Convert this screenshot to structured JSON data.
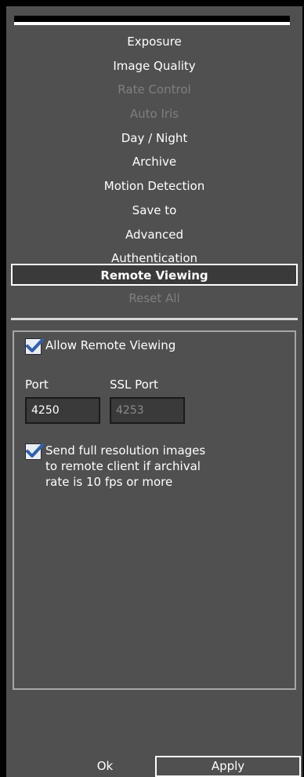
{
  "menu": {
    "items": [
      {
        "label": "Exposure",
        "state": "enabled"
      },
      {
        "label": "Image Quality",
        "state": "enabled"
      },
      {
        "label": "Rate Control",
        "state": "disabled"
      },
      {
        "label": "Auto Iris",
        "state": "disabled"
      },
      {
        "label": "Day / Night",
        "state": "enabled"
      },
      {
        "label": "Archive",
        "state": "enabled"
      },
      {
        "label": "Motion Detection",
        "state": "enabled"
      },
      {
        "label": "Save to",
        "state": "enabled"
      },
      {
        "label": "Advanced",
        "state": "enabled"
      },
      {
        "label": "Authentication",
        "state": "enabled"
      }
    ],
    "selected_label": "Remote Viewing",
    "reset_label": "Reset All"
  },
  "panel": {
    "allow_remote_viewing": {
      "label": "Allow Remote Viewing",
      "checked": true
    },
    "port": {
      "label": "Port",
      "value": "4250"
    },
    "ssl_port": {
      "label": "SSL Port",
      "value": "4253",
      "enabled": false
    },
    "full_resolution": {
      "checked": true,
      "line1": "Send full resolution images",
      "line2": "to remote client if archival",
      "line3": "rate is 10 fps or more"
    }
  },
  "footer": {
    "ok_label": "Ok",
    "apply_label": "Apply"
  },
  "colors": {
    "background": "#505050",
    "frame": "#000000",
    "text": "#ffffff",
    "disabled_text": "#7f7f7f",
    "checkbox_check": "#2f5fb3"
  }
}
